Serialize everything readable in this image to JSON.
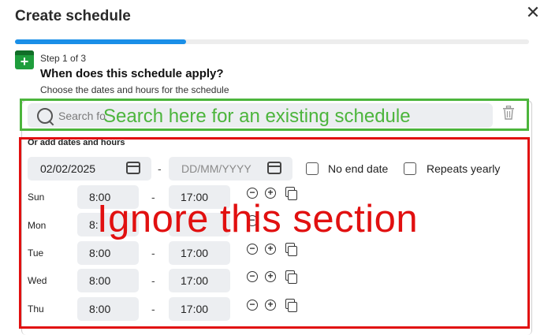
{
  "dialog": {
    "title": "Create schedule",
    "close_icon": "close-icon",
    "progress_fraction": 0.333
  },
  "step": {
    "icon": "calendar-add-icon",
    "label": "Step 1 of 3",
    "question": "When does this schedule apply?",
    "subtitle": "Choose the dates and hours for the schedule"
  },
  "search": {
    "placeholder": "Search fo",
    "icon": "search-icon",
    "delete_icon": "trash-icon"
  },
  "annotations": {
    "green_text": "Search here for an existing schedule",
    "red_text": "Ignore this section",
    "green_color": "#4cb53c",
    "red_color": "#e11010"
  },
  "dates": {
    "heading": "Or add dates and hours",
    "start_date": "02/02/2025",
    "end_placeholder": "DD/MM/YYYY",
    "separator": "-",
    "no_end_date_label": "No end date",
    "repeats_yearly_label": "Repeats yearly"
  },
  "days": [
    {
      "name": "Sun",
      "start": "8:00",
      "end": "17:00"
    },
    {
      "name": "Mon",
      "start": "8:",
      "end": ""
    },
    {
      "name": "Tue",
      "start": "8:00",
      "end": "17:00"
    },
    {
      "name": "Wed",
      "start": "8:00",
      "end": "17:00"
    },
    {
      "name": "Thu",
      "start": "8:00",
      "end": "17:00"
    }
  ],
  "time_separator": "-",
  "colors": {
    "accent": "#1a8fe8",
    "step_icon": "#1e9d3c"
  }
}
